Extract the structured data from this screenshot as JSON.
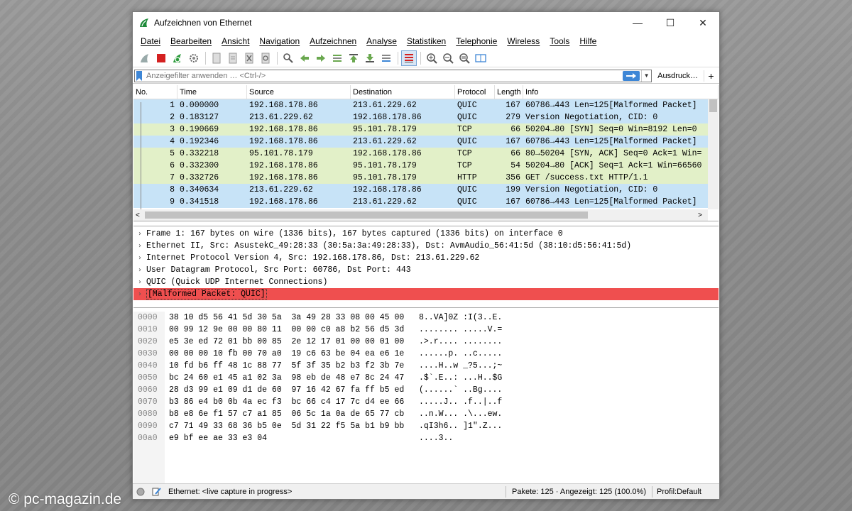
{
  "window": {
    "title": "Aufzeichnen von Ethernet",
    "minimize": "—",
    "maximize": "☐",
    "close": "✕"
  },
  "menu": [
    "Datei",
    "Bearbeiten",
    "Ansicht",
    "Navigation",
    "Aufzeichnen",
    "Analyse",
    "Statistiken",
    "Telephonie",
    "Wireless",
    "Tools",
    "Hilfe"
  ],
  "toolbar_icons": [
    "shark-fin-icon",
    "stop-icon",
    "restart-icon",
    "options-gear-icon",
    "open-file-icon",
    "save-file-icon",
    "close-file-icon",
    "reload-icon",
    "find-icon",
    "back-icon",
    "forward-icon",
    "goto-icon",
    "first-icon",
    "last-icon",
    "autoscroll-icon",
    "colorize-icon",
    "zoom-in-icon",
    "zoom-out-icon",
    "zoom-reset-icon",
    "resize-columns-icon"
  ],
  "filter": {
    "placeholder": "Anzeigefilter anwenden … <Ctrl-/>",
    "expression_label": "Ausdruck…",
    "add_label": "+"
  },
  "packet_list": {
    "columns": {
      "no": "No.",
      "time": "Time",
      "source": "Source",
      "destination": "Destination",
      "protocol": "Protocol",
      "length": "Length",
      "info": "Info"
    },
    "rows": [
      {
        "no": "1",
        "time": "0.000000",
        "source": "192.168.178.86",
        "destination": "213.61.229.62",
        "protocol": "QUIC",
        "length": "167",
        "info": "60786→443 Len=125[Malformed Packet]"
      },
      {
        "no": "2",
        "time": "0.183127",
        "source": "213.61.229.62",
        "destination": "192.168.178.86",
        "protocol": "QUIC",
        "length": "279",
        "info": "Version Negotiation, CID: 0"
      },
      {
        "no": "3",
        "time": "0.190669",
        "source": "192.168.178.86",
        "destination": "95.101.78.179",
        "protocol": "TCP",
        "length": "66",
        "info": "50204→80 [SYN] Seq=0 Win=8192 Len=0"
      },
      {
        "no": "4",
        "time": "0.192346",
        "source": "192.168.178.86",
        "destination": "213.61.229.62",
        "protocol": "QUIC",
        "length": "167",
        "info": "60786→443 Len=125[Malformed Packet]"
      },
      {
        "no": "5",
        "time": "0.332218",
        "source": "95.101.78.179",
        "destination": "192.168.178.86",
        "protocol": "TCP",
        "length": "66",
        "info": "80→50204 [SYN, ACK] Seq=0 Ack=1 Win="
      },
      {
        "no": "6",
        "time": "0.332300",
        "source": "192.168.178.86",
        "destination": "95.101.78.179",
        "protocol": "TCP",
        "length": "54",
        "info": "50204→80 [ACK] Seq=1 Ack=1 Win=66560"
      },
      {
        "no": "7",
        "time": "0.332726",
        "source": "192.168.178.86",
        "destination": "95.101.78.179",
        "protocol": "HTTP",
        "length": "356",
        "info": "GET /success.txt HTTP/1.1"
      },
      {
        "no": "8",
        "time": "0.340634",
        "source": "213.61.229.62",
        "destination": "192.168.178.86",
        "protocol": "QUIC",
        "length": "199",
        "info": "Version Negotiation, CID: 0"
      },
      {
        "no": "9",
        "time": "0.341518",
        "source": "192.168.178.86",
        "destination": "213.61.229.62",
        "protocol": "QUIC",
        "length": "167",
        "info": "60786→443 Len=125[Malformed Packet]"
      }
    ],
    "colors": {
      "quic": "#c7e3f7",
      "tcp": "#e2f0c8",
      "malformed": "#ef4f4f"
    }
  },
  "details": [
    {
      "text": "Frame 1: 167 bytes on wire (1336 bits), 167 bytes captured (1336 bits) on interface 0",
      "malformed": false
    },
    {
      "text": "Ethernet II, Src: AsustekC_49:28:33 (30:5a:3a:49:28:33), Dst: AvmAudio_56:41:5d (38:10:d5:56:41:5d)",
      "malformed": false
    },
    {
      "text": "Internet Protocol Version 4, Src: 192.168.178.86, Dst: 213.61.229.62",
      "malformed": false
    },
    {
      "text": "User Datagram Protocol, Src Port: 60786, Dst Port: 443",
      "malformed": false
    },
    {
      "text": "QUIC (Quick UDP Internet Connections)",
      "malformed": false
    },
    {
      "text": "[Malformed Packet: QUIC]",
      "malformed": true
    }
  ],
  "hex": [
    {
      "off": "0000",
      "bytes": "38 10 d5 56 41 5d 30 5a  3a 49 28 33 08 00 45 00",
      "ascii": "8..VA]0Z :I(3..E."
    },
    {
      "off": "0010",
      "bytes": "00 99 12 9e 00 00 80 11  00 00 c0 a8 b2 56 d5 3d",
      "ascii": "........ .....V.="
    },
    {
      "off": "0020",
      "bytes": "e5 3e ed 72 01 bb 00 85  2e 12 17 01 00 00 01 00",
      "ascii": ".>.r.... ........"
    },
    {
      "off": "0030",
      "bytes": "00 00 00 10 fb 00 70 a0  19 c6 63 be 04 ea e6 1e",
      "ascii": "......p. ..c....."
    },
    {
      "off": "0040",
      "bytes": "10 fd b6 ff 48 1c 88 77  5f 3f 35 b2 b3 f2 3b 7e",
      "ascii": "....H..w _?5...;~"
    },
    {
      "off": "0050",
      "bytes": "bc 24 60 e1 45 a1 02 3a  98 eb de 48 e7 8c 24 47",
      "ascii": ".$`.E..: ...H..$G"
    },
    {
      "off": "0060",
      "bytes": "28 d3 99 e1 09 d1 de 60  97 16 42 67 fa ff b5 ed",
      "ascii": "(......` ..Bg...."
    },
    {
      "off": "0070",
      "bytes": "b3 86 e4 b0 0b 4a ec f3  bc 66 c4 17 7c d4 ee 66",
      "ascii": ".....J.. .f..|..f"
    },
    {
      "off": "0080",
      "bytes": "b8 e8 6e f1 57 c7 a1 85  06 5c 1a 0a de 65 77 cb",
      "ascii": "..n.W... .\\...ew."
    },
    {
      "off": "0090",
      "bytes": "c7 71 49 33 68 36 b5 0e  5d 31 22 f5 5a b1 b9 bb",
      "ascii": ".qI3h6.. ]1\".Z..."
    },
    {
      "off": "00a0",
      "bytes": "e9 bf ee ae 33 e3 04",
      "ascii": "....3.."
    }
  ],
  "status": {
    "capture": "Ethernet: <live capture in progress>",
    "packets": "Pakete: 125 · Angezeigt: 125 (100.0%)",
    "profile": "Profil:Default"
  },
  "watermark": "© pc-magazin.de"
}
